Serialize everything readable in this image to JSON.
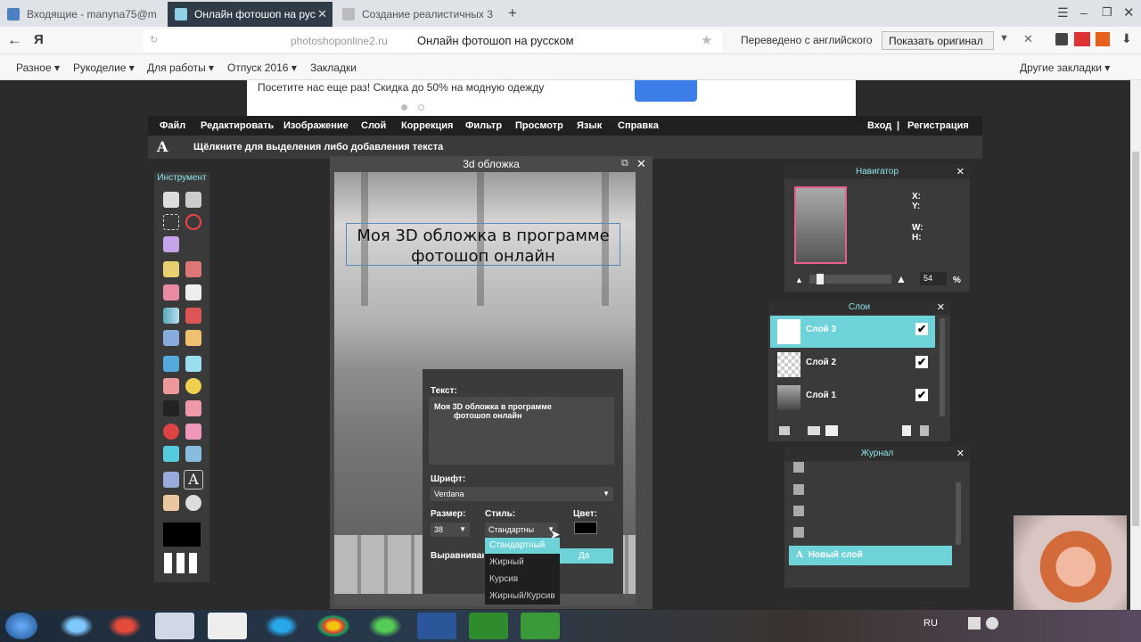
{
  "browser": {
    "tabs": [
      {
        "label": "Входящие - manyna75@m",
        "active": false
      },
      {
        "label": "Онлайн фотошоп на рус",
        "active": true
      },
      {
        "label": "Создание реалистичных 3",
        "active": false
      }
    ],
    "new_tab_icon": "+",
    "address": {
      "domain": "photoshoponline2.ru",
      "title": "Онлайн фотошоп на русском"
    },
    "translate": {
      "label": "Переведено с английского",
      "button": "Показать оригинал"
    },
    "bookmarks": [
      "Разное",
      "Рукоделие",
      "Для работы",
      "Отпуск 2016",
      "Закладки"
    ],
    "other_bookmarks": "Другие закладки"
  },
  "ad": {
    "text": "Посетите нас еще раз! Скидка до 50% на модную одежду"
  },
  "editor": {
    "menu": [
      "Файл",
      "Редактировать",
      "Изображение",
      "Слой",
      "Коррекция",
      "Фильтр",
      "Просмотр",
      "Язык",
      "Справка"
    ],
    "login": "Вход",
    "separator": "|",
    "register": "Регистрация",
    "options_hint": "Щёлкните для выделения либо добавления текста",
    "tools_title": "Инструмент",
    "document": {
      "title": "3d обложка",
      "text_line1": "Моя 3D обложка в программе",
      "text_line2": "фотошоп онлайн"
    },
    "text_dialog": {
      "text_label": "Текст:",
      "text_value_line1": "Моя 3D обложка в программе",
      "text_value_line2": "фотошоп онлайн",
      "font_label": "Шрифт:",
      "font_value": "Verdana",
      "size_label": "Размер:",
      "size_value": "38",
      "style_label": "Стиль:",
      "style_value": "Стандартны",
      "color_label": "Цвет:",
      "align_label": "Выравниван",
      "ok_label": "Да",
      "style_options": [
        "Стандартный",
        "Жирный",
        "Курсив",
        "Жирный/Курсив"
      ]
    },
    "navigator": {
      "title": "Навигатор",
      "x": "X:",
      "y": "Y:",
      "w": "W:",
      "h": "H:",
      "zoom": "54",
      "zoom_unit": "%"
    },
    "layers": {
      "title": "Слои",
      "items": [
        {
          "name": "Слой 3",
          "checked": true,
          "selected": true
        },
        {
          "name": "Слой 2",
          "checked": true,
          "selected": false
        },
        {
          "name": "Слой 1",
          "checked": true,
          "selected": false
        }
      ]
    },
    "journal": {
      "title": "Журнал",
      "selected": "Новый слой"
    }
  },
  "taskbar": {
    "lang": "RU"
  },
  "colors": {
    "accent": "#6ed3d9",
    "menubar": "#202020",
    "panel": "#3a3a3a"
  }
}
